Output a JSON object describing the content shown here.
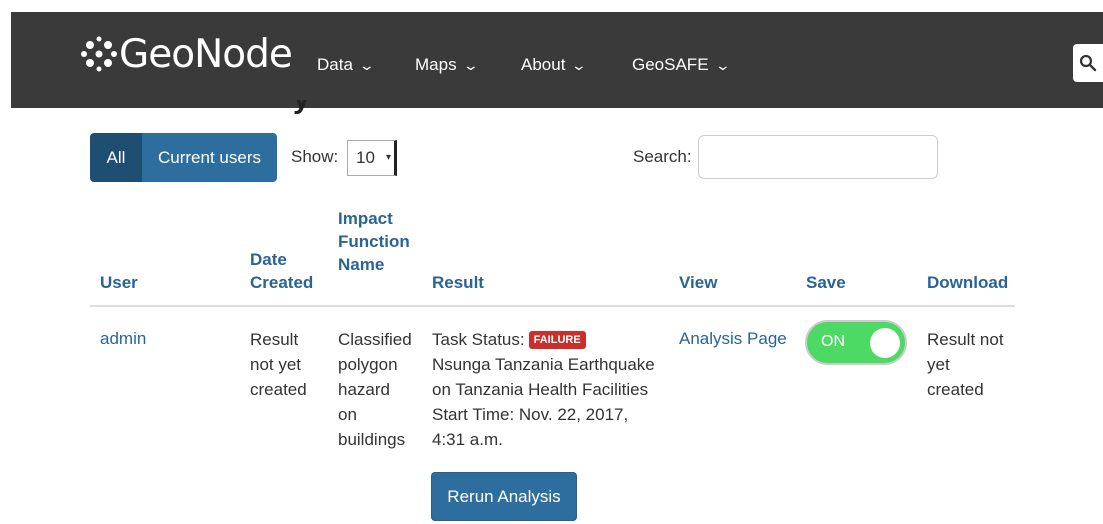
{
  "navbar": {
    "brand": "GeoNode",
    "menu": [
      {
        "label": "Data"
      },
      {
        "label": "Maps"
      },
      {
        "label": "About"
      },
      {
        "label": "GeoSAFE"
      }
    ]
  },
  "toolbar": {
    "filter_all": "All",
    "filter_current": "Current users",
    "show_label": "Show:",
    "show_value": "10",
    "search_label": "Search:",
    "search_value": ""
  },
  "table": {
    "headers": {
      "user": "User",
      "date_created_1": "Date",
      "date_created_2": "Created",
      "impact_1": "Impact",
      "impact_2": "Function",
      "impact_3": "Name",
      "result": "Result",
      "view": "View",
      "save": "Save",
      "download": "Download"
    },
    "rows": [
      {
        "user": "admin",
        "date_1": "Result",
        "date_2": "not yet",
        "date_3": "created",
        "impact_1": "Classified",
        "impact_2": "polygon",
        "impact_3": "hazard",
        "impact_4": "on",
        "impact_5": "buildings",
        "task_status_label": "Task Status:",
        "task_status": "FAILURE",
        "result_1": "Nsunga Tanzania Earthquake",
        "result_2": "on Tanzania Health Facilities",
        "result_3": "Start Time: Nov. 22, 2017,",
        "result_4": "4:31 a.m.",
        "rerun": "Rerun Analysis",
        "view": "Analysis Page",
        "save_toggle": "ON",
        "download_1": "Result not",
        "download_2": "yet",
        "download_3": "created"
      }
    ]
  },
  "colors": {
    "navbar": "#3a3a3a",
    "link": "#2a6496",
    "primary_button": "#2e6e9e",
    "active_filter": "#1f4e73",
    "failure_badge": "#c9302c",
    "toggle_on": "#4cd964"
  }
}
